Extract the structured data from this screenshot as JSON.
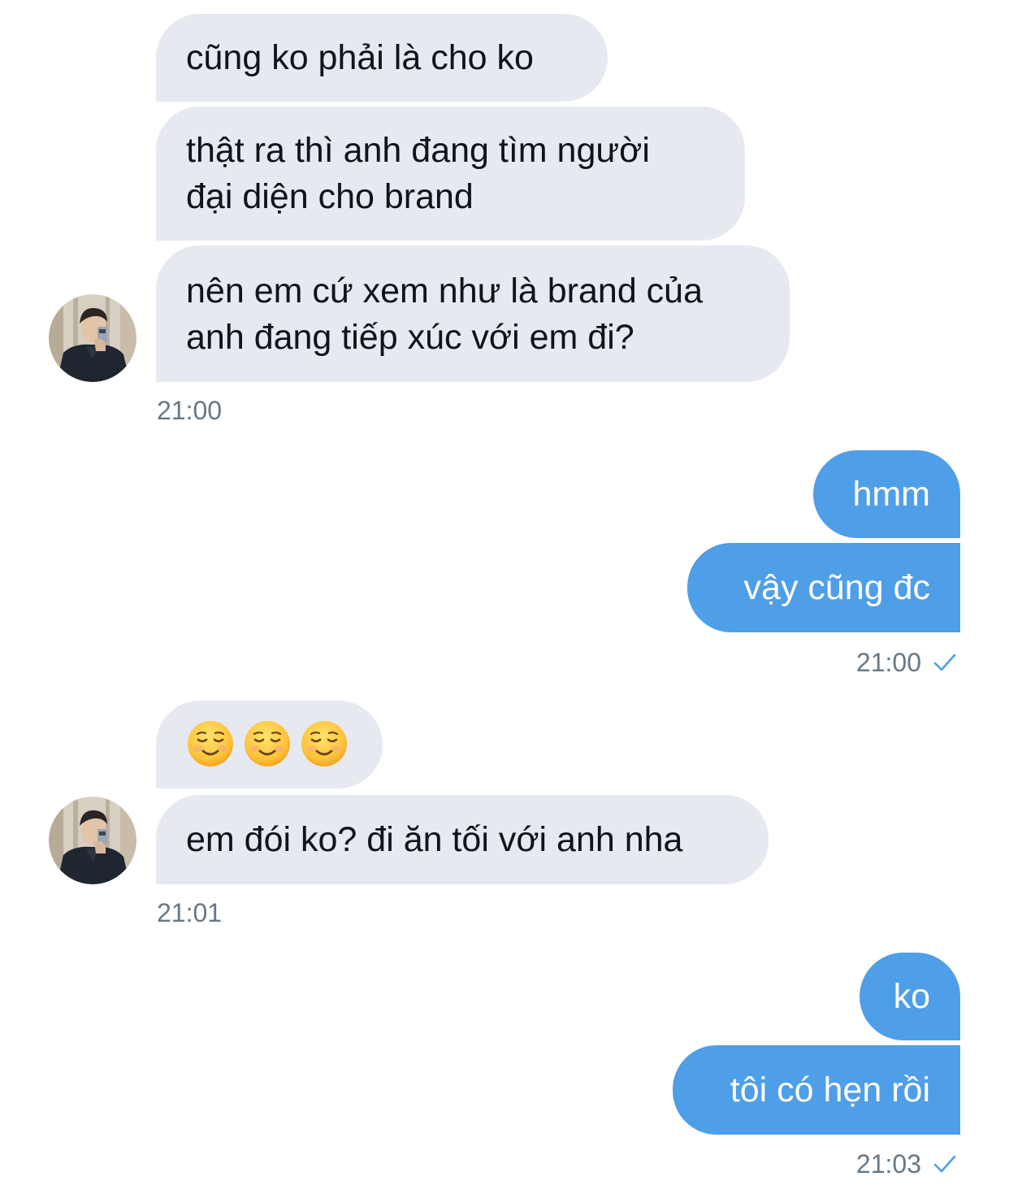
{
  "conversation": {
    "group1": {
      "messages": [
        "cũng ko phải là cho ko",
        "thật ra thì anh đang tìm người",
        "đại diện cho brand",
        "nên em cứ xem như là brand của",
        "anh đang tiếp xúc với em đi?"
      ],
      "time": "21:00"
    },
    "group2": {
      "messages": [
        "hmm",
        "vậy cũng đc"
      ],
      "time": "21:00",
      "status_icon": "sent-checkmark-icon"
    },
    "group3": {
      "emoji_icons": [
        "smiling-face-icon",
        "smiling-face-icon",
        "smiling-face-icon"
      ],
      "messages": [
        "em đói ko? đi ăn tối với anh nha"
      ],
      "time": "21:01"
    },
    "group4": {
      "messages": [
        "ko",
        "tôi có hẹn rồi"
      ],
      "time": "21:03",
      "status_icon": "sent-checkmark-icon"
    }
  },
  "colors": {
    "incoming_bubble": "#e6e9f0",
    "outgoing_bubble": "#4f9ee8",
    "timestamp": "#697784",
    "checkmark": "#4f9ee8"
  }
}
